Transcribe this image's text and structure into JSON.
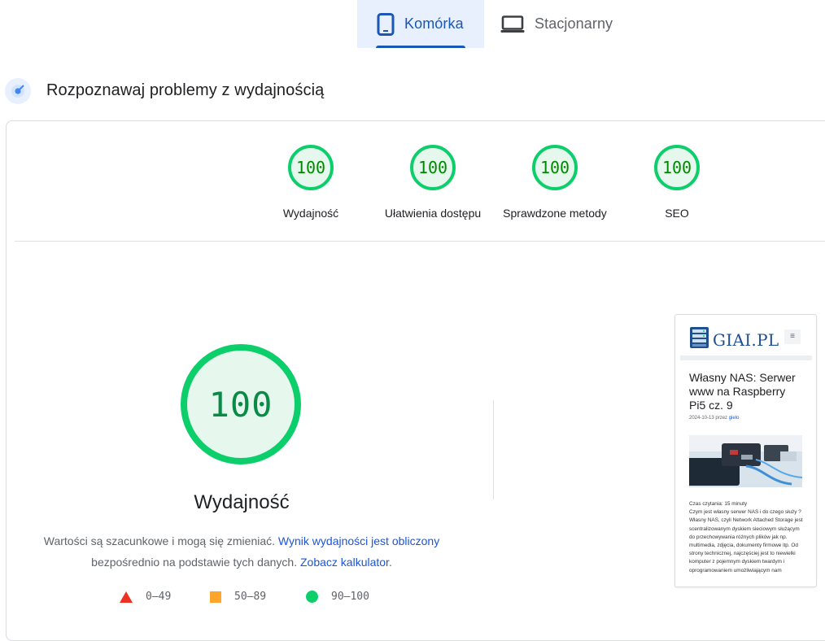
{
  "tabs": [
    {
      "label": "Komórka",
      "active": true,
      "icon": "smartphone-icon"
    },
    {
      "label": "Stacjonarny",
      "active": false,
      "icon": "laptop-icon"
    }
  ],
  "section": {
    "title": "Rozpoznawaj problemy z wydajnością",
    "icon": "lighthouse-icon"
  },
  "gauges": [
    {
      "score": "100",
      "label": "Wydajność"
    },
    {
      "score": "100",
      "label": "Ułatwienia dostępu"
    },
    {
      "score": "100",
      "label": "Sprawdzone metody"
    },
    {
      "score": "100",
      "label": "SEO"
    }
  ],
  "performance": {
    "score": "100",
    "title": "Wydajność",
    "desc_text_1": "Wartości są szacunkowe i mogą się zmieniać. ",
    "desc_link_1": "Wynik wydajności jest obliczony",
    "desc_text_2": " bezpośrednio na podstawie tych danych. ",
    "desc_link_2": "Zobacz kalkulator",
    "desc_text_3": "."
  },
  "legend": [
    {
      "range": "0–49",
      "shape": "triangle",
      "color": "#eb3223"
    },
    {
      "range": "50–89",
      "shape": "square",
      "color": "#ffa52b"
    },
    {
      "range": "90–100",
      "shape": "circle",
      "color": "#0cce6b"
    }
  ],
  "preview": {
    "site_name": "GIAI.PL",
    "menu_glyph": "≡",
    "post_title": "Własny NAS: Serwer www na Raspberry Pi5 cz. 9",
    "post_date": "2024-10-13 przez",
    "post_author": "gielo",
    "body_lines": [
      "Czas czytania: 15 minuty",
      "Czym jest własny serwer NAS i do czego służy ? Własny NAS, czyli Network Attached Storage jest scentralizowanym dyskiem sieciowym służącym do przechowywania różnych plików jak np. multimedia, zdjęcia, dokumenty firmowe itp. Od strony technicznej, najczęściej jest to niewielki komputer z pojemnym dyskiem twardym i oprogramowaniem umożliwiającym nam"
    ]
  },
  "colors": {
    "pass": "#0cce6b",
    "pass_text": "#008800",
    "pass_fill": "#e6f7ed",
    "accent": "#1a56b5",
    "link": "#1a56d6"
  }
}
